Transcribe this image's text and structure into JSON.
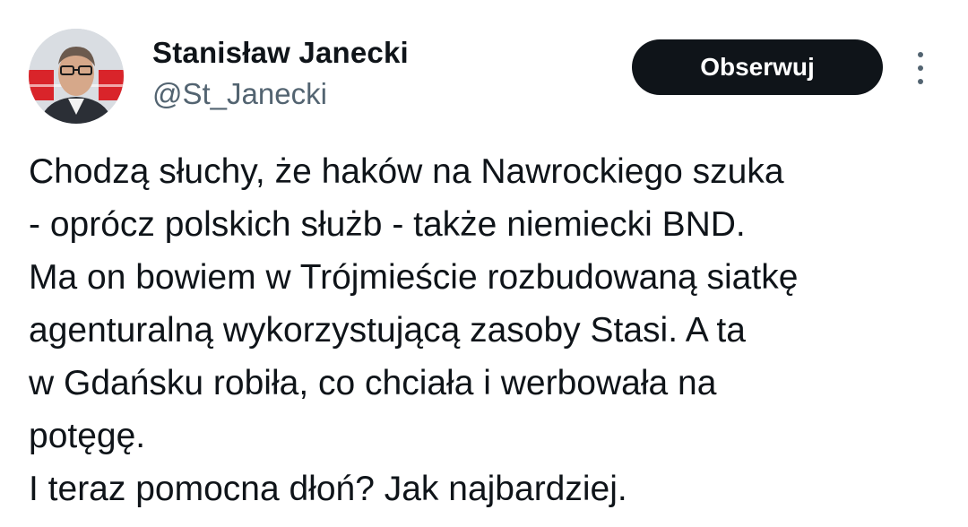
{
  "author": {
    "name": "Stanisław Janecki",
    "handle": "@St_Janecki",
    "avatar_icon": "user-avatar-photo"
  },
  "actions": {
    "follow_label": "Obserwuj",
    "more_icon": "more-vertical-icon"
  },
  "tweet": {
    "lines": [
      "Chodzą słuchy, że haków na Nawrockiego szuka",
      "- oprócz polskich służb - także niemiecki BND.",
      "Ma on bowiem w Trójmieście rozbudowaną siatkę",
      "agenturalną wykorzystującą zasoby Stasi. A ta",
      "w Gdańsku robiła, co chciała i werbowała na",
      "potęgę.",
      "I teraz pomocna dłoń? Jak najbardziej."
    ]
  },
  "colors": {
    "text": "#0f1419",
    "secondary": "#536471",
    "button_bg": "#0f1419",
    "button_text": "#ffffff"
  }
}
